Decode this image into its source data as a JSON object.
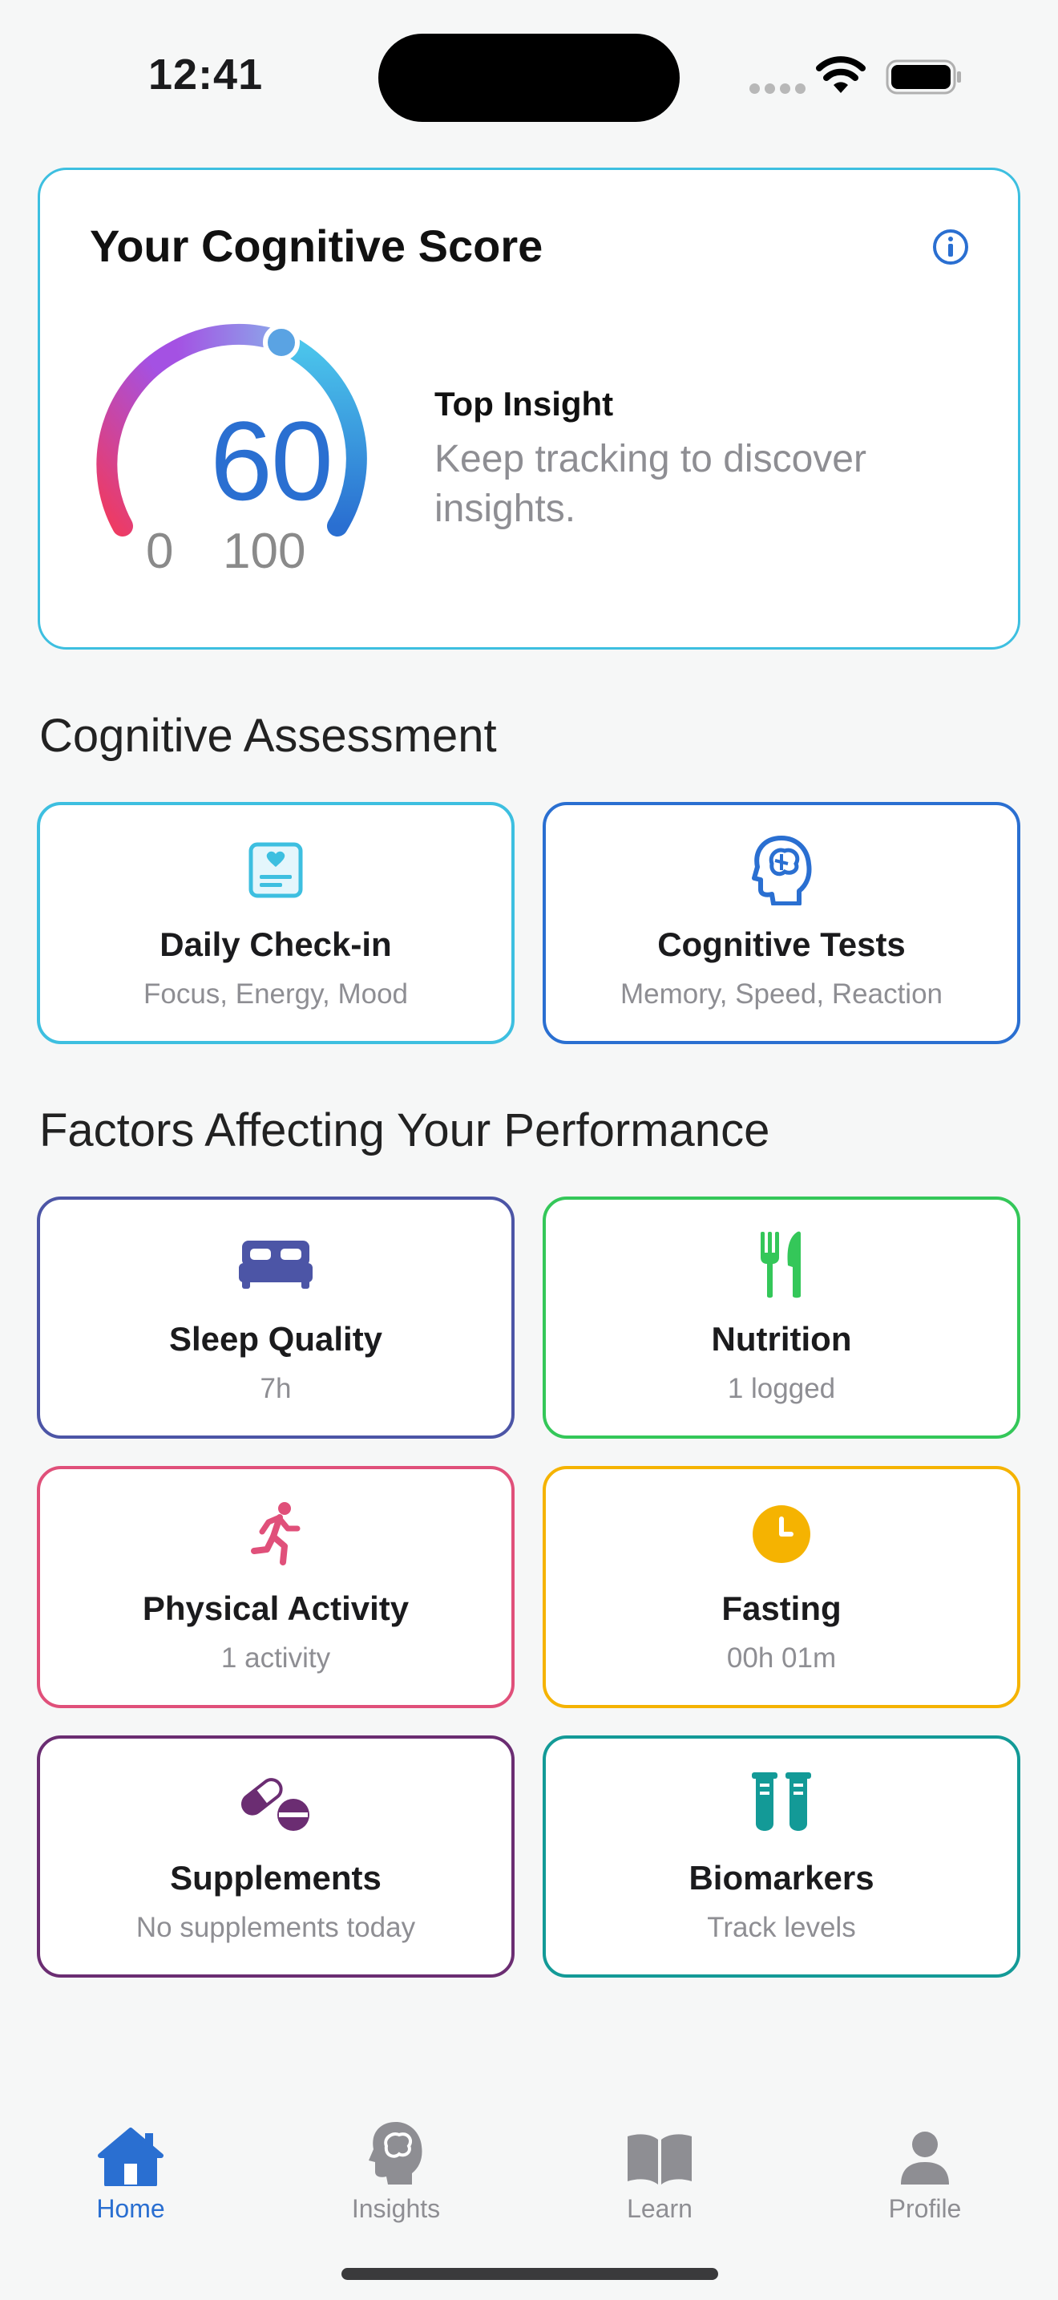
{
  "status": {
    "time": "12:41"
  },
  "score_card": {
    "title": "Your Cognitive Score",
    "score": "60",
    "min": "0",
    "max": "100",
    "score_fraction": 0.6,
    "insight_title": "Top Insight",
    "insight_text": "Keep tracking to discover insights."
  },
  "assessment": {
    "heading": "Cognitive Assessment",
    "tiles": [
      {
        "title": "Daily Check-in",
        "subtitle": "Focus, Energy, Mood",
        "icon": "checkin-card-icon",
        "color": "#3dbfe0"
      },
      {
        "title": "Cognitive Tests",
        "subtitle": "Memory, Speed, Reaction",
        "icon": "brain-head-icon",
        "color": "#2a6fd1"
      }
    ]
  },
  "factors": {
    "heading": "Factors Affecting Your Performance",
    "tiles": [
      {
        "title": "Sleep Quality",
        "subtitle": "7h",
        "icon": "bed-icon",
        "color": "#4c55a6"
      },
      {
        "title": "Nutrition",
        "subtitle": "1 logged",
        "icon": "fork-knife-icon",
        "color": "#34c759"
      },
      {
        "title": "Physical Activity",
        "subtitle": "1 activity",
        "icon": "runner-icon",
        "color": "#e0507a"
      },
      {
        "title": "Fasting",
        "subtitle": "00h 01m",
        "icon": "clock-icon",
        "color": "#f5b301"
      },
      {
        "title": "Supplements",
        "subtitle": "No supplements today",
        "icon": "pills-icon",
        "color": "#6b2d72"
      },
      {
        "title": "Biomarkers",
        "subtitle": "Track levels",
        "icon": "test-tubes-icon",
        "color": "#139a97"
      }
    ]
  },
  "tabs": [
    {
      "label": "Home",
      "icon": "house-icon",
      "active": true
    },
    {
      "label": "Insights",
      "icon": "brain-head-icon",
      "active": false
    },
    {
      "label": "Learn",
      "icon": "book-icon",
      "active": false
    },
    {
      "label": "Profile",
      "icon": "person-icon",
      "active": false
    }
  ],
  "colors": {
    "accent": "#2a6fd1",
    "tab_inactive": "#8e8e93"
  }
}
